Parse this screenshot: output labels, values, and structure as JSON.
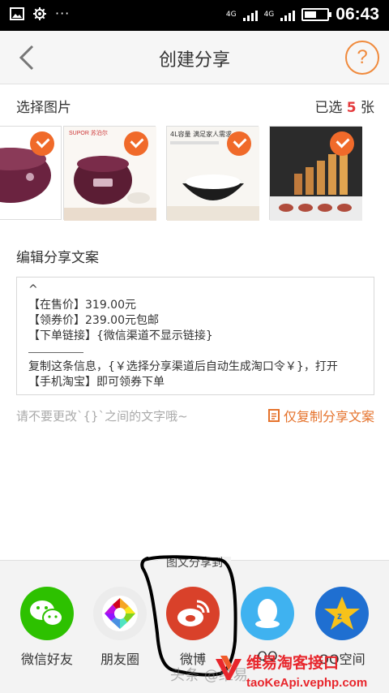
{
  "status_bar": {
    "time": "06:43",
    "network": "4G",
    "network2": "4G"
  },
  "nav": {
    "title": "创建分享",
    "help_symbol": "?"
  },
  "select": {
    "title": "选择图片",
    "count_prefix": "已选",
    "count": "5",
    "count_suffix": "张"
  },
  "thumbnails": [
    {
      "label": "",
      "checked": true
    },
    {
      "label": "SUPOR 苏泊尔",
      "checked": true
    },
    {
      "label": "4L容量 满足家人需求",
      "checked": true
    },
    {
      "label": "",
      "checked": true
    }
  ],
  "edit": {
    "title": "编辑分享文案",
    "lines": [
      "^",
      "【在售价】319.00元",
      "【领券价】239.00元包邮",
      "【下单链接】{微信渠道不显示链接}",
      "复制这条信息，{￥选择分享渠道后自动生成淘口令￥}，打开",
      "【手机淘宝】即可领券下单"
    ]
  },
  "hint": "请不要更改`{}`之间的文字哦~",
  "copy_button": "仅复制分享文案",
  "share": {
    "title": "图文分享到",
    "items": [
      {
        "label": "微信好友",
        "icon": "wechat-icon",
        "color": "#2dc100"
      },
      {
        "label": "朋友圈",
        "icon": "moments-icon",
        "color": "#ececec"
      },
      {
        "label": "微博",
        "icon": "weibo-icon",
        "color": "#d9412a"
      },
      {
        "label": "QQ",
        "icon": "qq-icon",
        "color": "#3fb2f0"
      },
      {
        "label": "QQ空间",
        "icon": "qzone-icon",
        "color": "#1f6fd1"
      }
    ]
  },
  "overlay": {
    "brand_name": "维易淘客接口",
    "brand_url": "taoKeApi.vephp.com",
    "watermark": "头条 @维易"
  },
  "colors": {
    "accent": "#f06a2a",
    "count": "#e4393c",
    "brand": "#e8262c"
  }
}
